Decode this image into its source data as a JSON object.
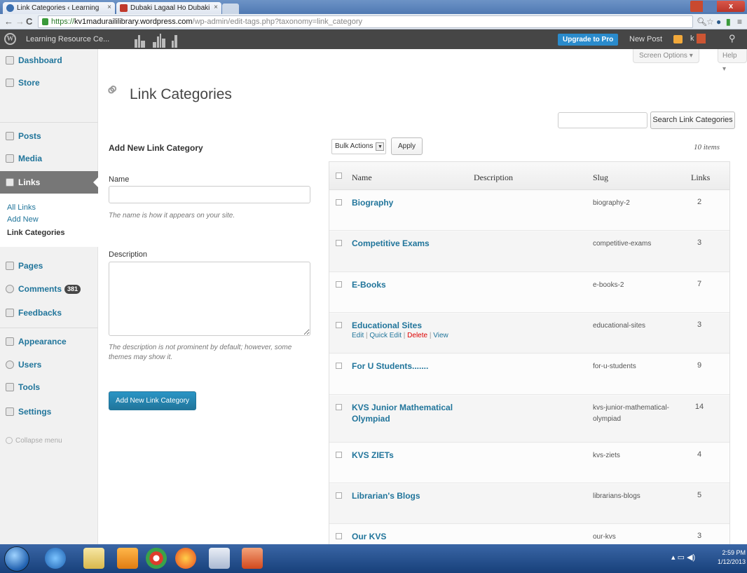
{
  "browser": {
    "tabs": [
      {
        "title": "Link Categories ‹ Learning",
        "icon_color": "#3a6fb0"
      },
      {
        "title": "Dubaki Lagaal Ho Dubaki",
        "icon_color": "#c0392b"
      }
    ],
    "tab_close": "×",
    "window_close": "x",
    "url_scheme": "https://",
    "url_host": "kv1maduraililibrary.wordpress.com",
    "url_path": "/wp-admin/edit-tags.php?taxonomy=link_category"
  },
  "adminbar": {
    "logo": "W",
    "site_name": "Learning Resource Ce...",
    "upgrade": "Upgrade to Pro",
    "new_post": "New Post",
    "user_initial": "k"
  },
  "sidebar": {
    "items": [
      {
        "label": "Dashboard"
      },
      {
        "label": "Store"
      },
      {
        "label": "Posts"
      },
      {
        "label": "Media"
      },
      {
        "label": "Links"
      },
      {
        "label": "Pages"
      },
      {
        "label": "Comments"
      },
      {
        "label": "Feedbacks"
      },
      {
        "label": "Appearance"
      },
      {
        "label": "Users"
      },
      {
        "label": "Tools"
      },
      {
        "label": "Settings"
      }
    ],
    "submenu": [
      "All Links",
      "Add New",
      "Link Categories"
    ],
    "comments_badge": "381",
    "collapse": "Collapse menu"
  },
  "header": {
    "screen_options": "Screen Options ▾",
    "help": "Help ▾",
    "title": "Link Categories",
    "search_button": "Search Link Categories"
  },
  "form": {
    "title": "Add New Link Category",
    "name_label": "Name",
    "name_hint": "The name is how it appears on your site.",
    "description_label": "Description",
    "description_hint_1": "The description is not prominent by default; however, some",
    "description_hint_2": "themes may show it.",
    "submit": "Add New Link Category"
  },
  "table": {
    "bulk_actions": "Bulk Actions",
    "apply": "Apply",
    "items_count": "10 items",
    "columns": {
      "name": "Name",
      "description": "Description",
      "slug": "Slug",
      "links": "Links"
    },
    "row_actions": {
      "edit": "Edit",
      "quick_edit": "Quick Edit",
      "delete": "Delete",
      "view": "View",
      "separator": "|"
    },
    "rows": [
      {
        "name": "Biography",
        "name2": "",
        "slug": "biography-2",
        "slug2": "",
        "links": "2"
      },
      {
        "name": "Competitive Exams",
        "name2": "",
        "slug": "competitive-exams",
        "slug2": "",
        "links": "3"
      },
      {
        "name": "E-Books",
        "name2": "",
        "slug": "e-books-2",
        "slug2": "",
        "links": "7"
      },
      {
        "name": "Educational Sites",
        "name2": "",
        "slug": "educational-sites",
        "slug2": "",
        "links": "3"
      },
      {
        "name": "For U Students.......",
        "name2": "",
        "slug": "for-u-students",
        "slug2": "",
        "links": "9"
      },
      {
        "name": "KVS Junior Mathematical",
        "name2": "Olympiad",
        "slug": "kvs-junior-mathematical-",
        "slug2": "olympiad",
        "links": "14"
      },
      {
        "name": "KVS ZIETs",
        "name2": "",
        "slug": "kvs-ziets",
        "slug2": "",
        "links": "4"
      },
      {
        "name": "Librarian's Blogs",
        "name2": "",
        "slug": "librarians-blogs",
        "slug2": "",
        "links": "5"
      },
      {
        "name": "Our KVS",
        "name2": "",
        "slug": "our-kvs",
        "slug2": "",
        "links": "3"
      }
    ]
  },
  "taskbar": {
    "time": "2:59 PM",
    "date": "1/12/2013"
  }
}
